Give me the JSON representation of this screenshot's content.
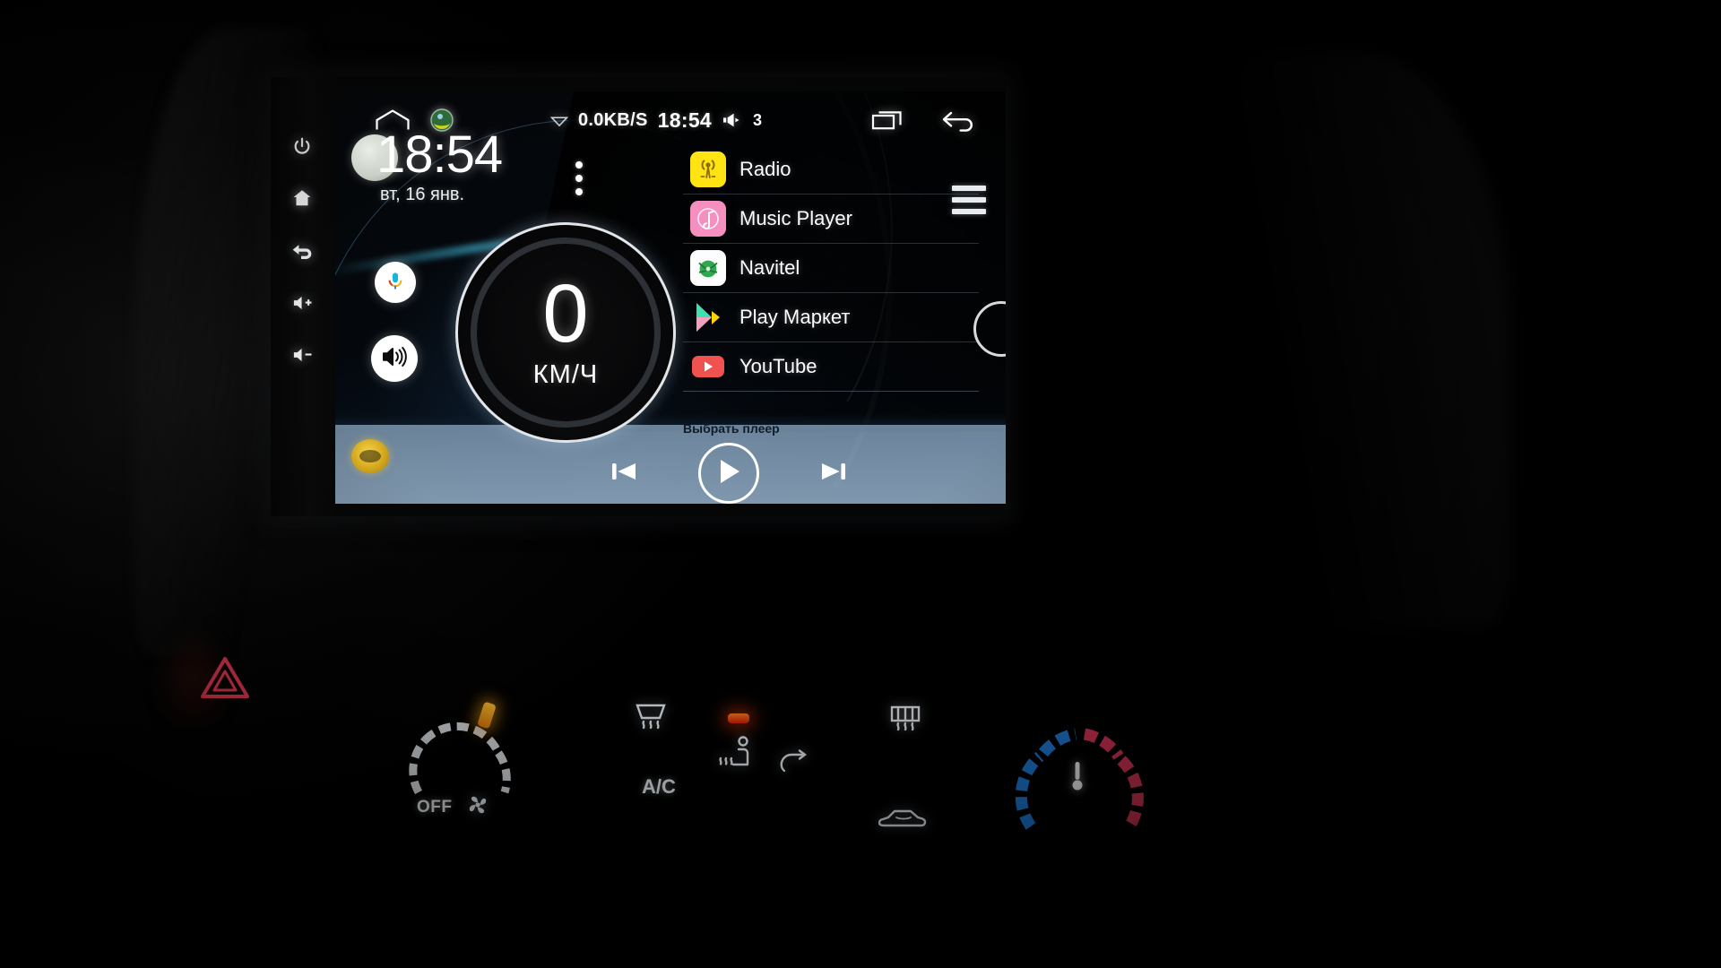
{
  "status_bar": {
    "home_icon": "home-outline-icon",
    "app_badge_icon": "navitel-badge-icon",
    "wifi_icon": "wifi-icon",
    "network_speed": "0.0KB/S",
    "time": "18:54",
    "volume_icon": "volume-icon",
    "volume_level": "3",
    "recents_icon": "recent-apps-icon",
    "back_icon": "back-arrow-icon"
  },
  "clock_widget": {
    "time": "18:54",
    "date": "вт, 16 янв.",
    "overflow_icon": "three-dots-vertical-icon",
    "dial_icon": "analog-clock-dial-icon"
  },
  "speedometer": {
    "value": "0",
    "unit": "КМ/Ч"
  },
  "shortcuts": [
    {
      "name": "voice-search",
      "icon": "microphone-icon"
    },
    {
      "name": "volume",
      "icon": "speaker-waves-icon"
    }
  ],
  "app_list": {
    "menu_icon": "hamburger-menu-icon",
    "items": [
      {
        "label": "Radio",
        "icon": "radio-tower-icon",
        "color": "#ffe312"
      },
      {
        "label": "Music Player",
        "icon": "music-note-icon",
        "color": "#f48fc0"
      },
      {
        "label": "Navitel",
        "icon": "navitel-globe-icon",
        "color": "#ffffff"
      },
      {
        "label": "Play Маркет",
        "icon": "google-play-icon",
        "color": "#00d0a0"
      },
      {
        "label": "YouTube",
        "icon": "youtube-icon",
        "color": "#f0534f"
      }
    ]
  },
  "media_bar": {
    "caption": "Выбрать плеер",
    "previous_icon": "skip-previous-icon",
    "play_icon": "play-icon",
    "next_icon": "skip-next-icon",
    "badge_icon": "steering-wheel-badge-icon"
  },
  "bezel_buttons": [
    {
      "name": "power",
      "icon": "power-icon"
    },
    {
      "name": "home",
      "icon": "home-icon"
    },
    {
      "name": "back",
      "icon": "back-icon"
    },
    {
      "name": "volume-up",
      "icon": "volume-up-icon"
    },
    {
      "name": "volume-down",
      "icon": "volume-down-icon"
    }
  ],
  "climate_console": {
    "hazard_icon": "hazard-triangle-icon",
    "fan_label": "OFF",
    "fan_icon": "fan-blades-icon",
    "ac_label": "A/C",
    "front_defrost_icon": "front-defrost-icon",
    "rear_defrost_icon": "rear-defrost-icon",
    "seat_heater_icon": "heated-seat-icon",
    "recirculate_icon": "air-recirculate-icon",
    "car_air_icon": "car-airflow-icon",
    "temperature_icon": "thermometer-icon",
    "cold_color": "#1f7fe0",
    "hot_color": "#e0365a"
  }
}
